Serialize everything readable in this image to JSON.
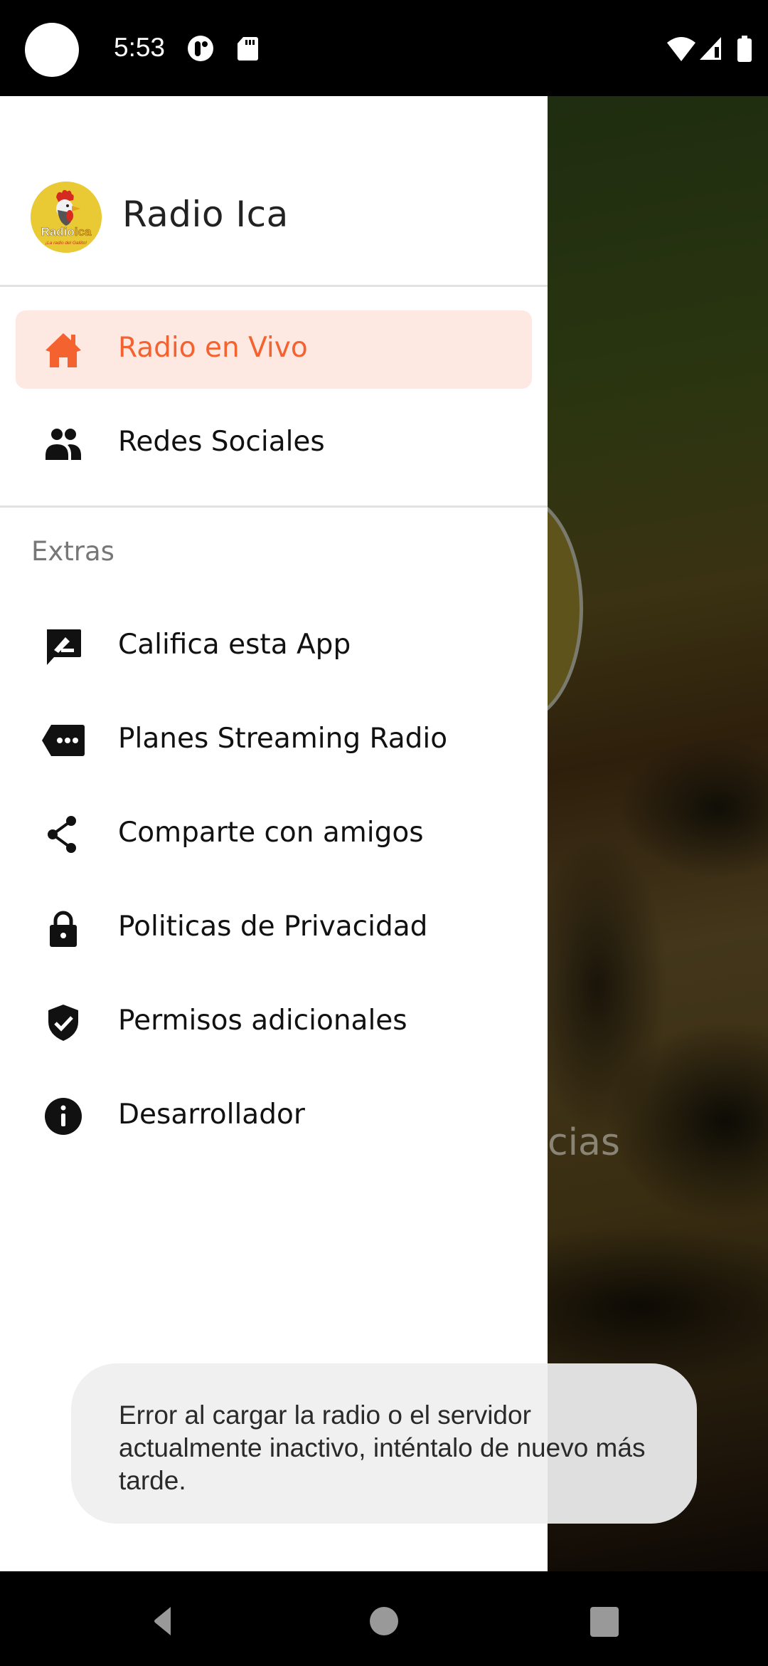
{
  "status_bar": {
    "time": "5:53",
    "left_icons": [
      "camera-cutout",
      "app-notification-icon",
      "sd-card-icon"
    ],
    "right_icons": [
      "wifi-icon",
      "cell-signal-icon",
      "battery-icon"
    ]
  },
  "background": {
    "partial_text": "cias"
  },
  "drawer": {
    "app_name": "Radio Ica",
    "logo": {
      "brand_text": "Radio ica",
      "tagline": "¡La radio del Gallito!"
    },
    "main_items": [
      {
        "label": "Radio en Vivo",
        "icon": "home-icon",
        "selected": true
      },
      {
        "label": "Redes Sociales",
        "icon": "people-icon",
        "selected": false
      }
    ],
    "section_title": "Extras",
    "extra_items": [
      {
        "label": "Califica esta App",
        "icon": "rate-review-icon"
      },
      {
        "label": "Planes Streaming Radio",
        "icon": "label-more-icon"
      },
      {
        "label": "Comparte con amigos",
        "icon": "share-icon"
      },
      {
        "label": "Politicas de Privacidad",
        "icon": "lock-icon"
      },
      {
        "label": "Permisos adicionales",
        "icon": "verified-shield-icon"
      },
      {
        "label": "Desarrollador",
        "icon": "info-icon"
      }
    ]
  },
  "toast": {
    "message": "Error al cargar la radio o el servidor actualmente inactivo, inténtalo de nuevo más tarde."
  },
  "nav_bar": {
    "back": "back-icon",
    "home": "home-circle-icon",
    "recents": "recents-icon"
  },
  "colors": {
    "accent": "#f4622f",
    "selected_bg": "#fde8e2",
    "logo_yellow": "#e9c934"
  }
}
